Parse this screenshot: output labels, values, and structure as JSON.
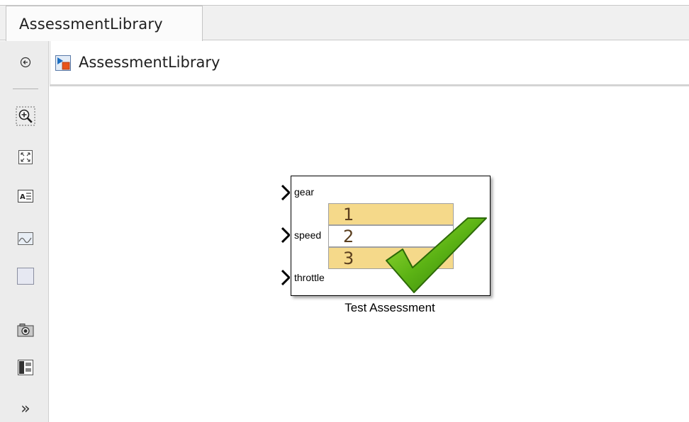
{
  "tab": {
    "title": "AssessmentLibrary"
  },
  "address": {
    "path": "AssessmentLibrary"
  },
  "palette": {
    "tools": [
      "back-arrow-icon",
      "zoom-icon",
      "fit-to-view-icon",
      "annotation-icon",
      "image-icon",
      "area-icon",
      "camera-icon",
      "model-browser-icon",
      "more-icon"
    ]
  },
  "block": {
    "name": "Test Assessment",
    "ports": [
      "gear",
      "speed",
      "throttle"
    ],
    "steps": [
      "1",
      "2",
      "3"
    ]
  },
  "colors": {
    "step_highlight": "#f5d98a",
    "check_green": "#4c9a10",
    "tab_bg": "#f0f0f0"
  }
}
